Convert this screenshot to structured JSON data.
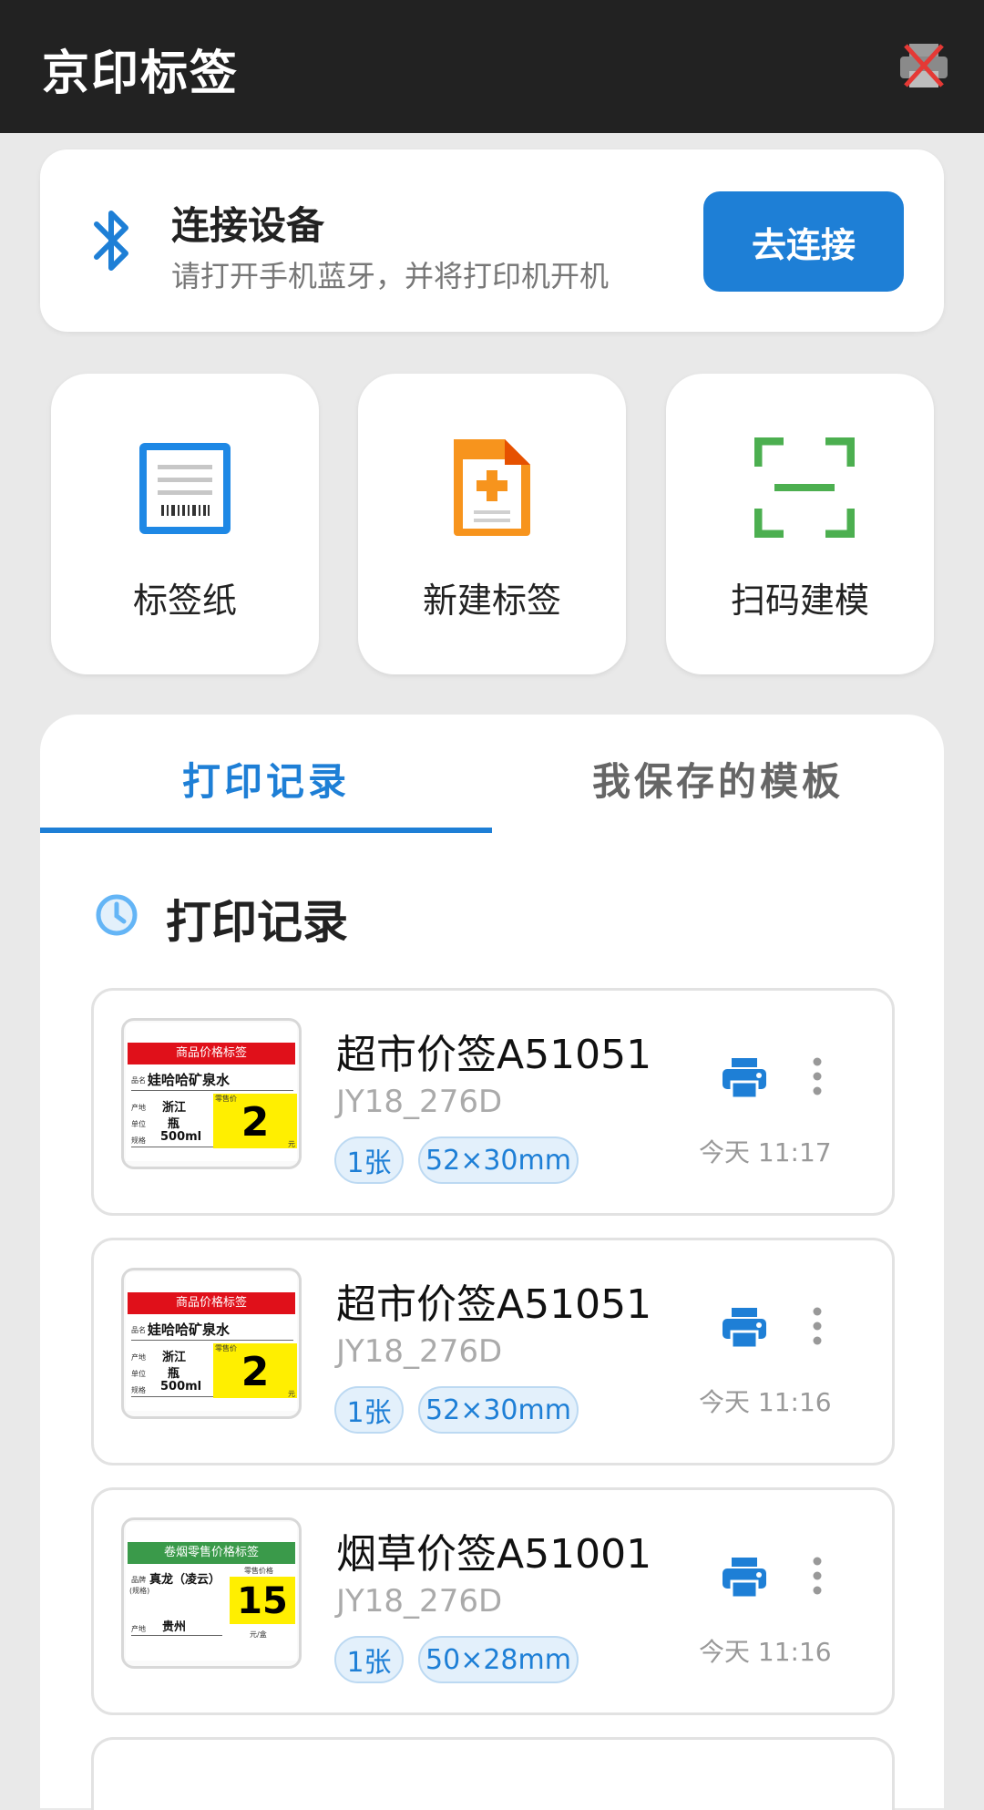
{
  "app": {
    "title": "京印标签",
    "printer_status_icon": "printer-disconnected-icon"
  },
  "connect": {
    "title": "连接设备",
    "subtitle": "请打开手机蓝牙，并将打印机开机",
    "button": "去连接",
    "icon": "bluetooth-icon"
  },
  "tiles": [
    {
      "label": "标签纸",
      "icon": "label-paper-icon"
    },
    {
      "label": "新建标签",
      "icon": "new-label-icon"
    },
    {
      "label": "扫码建模",
      "icon": "scan-icon"
    }
  ],
  "tabs": [
    {
      "label": "打印记录",
      "active": true
    },
    {
      "label": "我保存的模板",
      "active": false
    }
  ],
  "section": {
    "title": "打印记录",
    "icon": "clock-icon"
  },
  "records": [
    {
      "name": "超市价签A51051",
      "model": "JY18_276D",
      "count": "1张",
      "size": "52×30mm",
      "time": "今天 11:17",
      "thumb": {
        "header": "商品价格标签",
        "product_label": "品名",
        "product": "娃哈哈矿泉水",
        "origin_label": "产地",
        "origin": "浙江",
        "unit_label": "单位",
        "unit": "瓶",
        "spec_label": "规格",
        "spec": "500ml",
        "price_label": "零售价",
        "price": "2",
        "currency": "元"
      }
    },
    {
      "name": "超市价签A51051",
      "model": "JY18_276D",
      "count": "1张",
      "size": "52×30mm",
      "time": "今天 11:16",
      "thumb": {
        "header": "商品价格标签",
        "product_label": "品名",
        "product": "娃哈哈矿泉水",
        "origin_label": "产地",
        "origin": "浙江",
        "unit_label": "单位",
        "unit": "瓶",
        "spec_label": "规格",
        "spec": "500ml",
        "price_label": "零售价",
        "price": "2",
        "currency": "元"
      }
    },
    {
      "name": "烟草价签A51001",
      "model": "JY18_276D",
      "count": "1张",
      "size": "50×28mm",
      "time": "今天 11:16",
      "thumb": {
        "header": "卷烟零售价格标签",
        "brand_label": "品牌",
        "spec_label": "(规格)",
        "brand": "真龙（凌云）",
        "origin_label": "产地",
        "origin": "贵州",
        "price_label": "零售价格",
        "price": "15",
        "currency": "元/盒"
      }
    }
  ],
  "colors": {
    "accent": "#1e7fd6",
    "appbar": "#222222",
    "label_red": "#e0101a",
    "label_green": "#3a9a4a",
    "price_yellow": "#ffef00",
    "scan_green": "#4caf50",
    "new_orange": "#f7941d"
  }
}
